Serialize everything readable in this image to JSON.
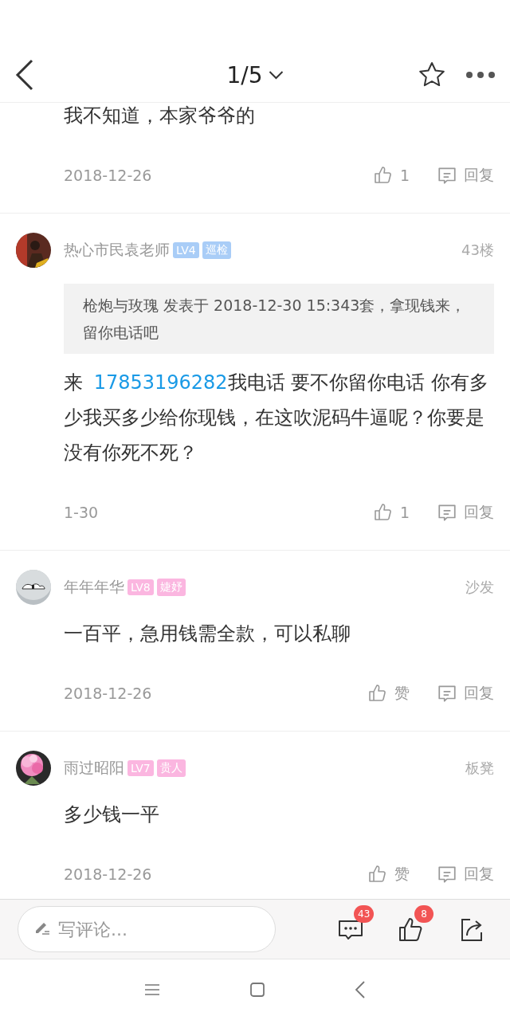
{
  "header": {
    "page": "1/5"
  },
  "first_comment": {
    "content": "我不知道，本家爷爷的",
    "date": "2018-12-26",
    "likes": "1",
    "reply": "回复"
  },
  "comments": [
    {
      "name": "热心市民袁老师",
      "badges": [
        {
          "text": "LV4",
          "color": "#a9cdf7"
        },
        {
          "text": "巡检",
          "color": "#a9cdf7"
        }
      ],
      "floor": "43楼",
      "quote": "枪炮与玫瑰 发表于 2018-12-30 15:343套，拿现钱来，留你电话吧",
      "content": [
        {
          "kind": "text",
          "text": "来 "
        },
        {
          "kind": "phone",
          "text": "17853196282"
        },
        {
          "kind": "text",
          "text": "我电话  要不你留你电话  你有多少我买多少给你现钱，在这吹泥码牛逼呢？你要是没有你死不死？"
        }
      ],
      "date": "1-30",
      "likes": "1",
      "reply": "回复"
    },
    {
      "name": "年年年华",
      "badges": [
        {
          "text": "LV8",
          "color": "#fbb6e0"
        },
        {
          "text": "婕妤",
          "color": "#fbb6e0"
        }
      ],
      "floor": "沙发",
      "content": [
        {
          "kind": "text",
          "text": "一百平，急用钱需全款，可以私聊"
        }
      ],
      "date": "2018-12-26",
      "likes": "赞",
      "reply": "回复"
    },
    {
      "name": "雨过昭阳",
      "badges": [
        {
          "text": "LV7",
          "color": "#fbb6e0"
        },
        {
          "text": "贵人",
          "color": "#fbb6e0"
        }
      ],
      "floor": "板凳",
      "content": [
        {
          "kind": "text",
          "text": "多少钱一平"
        }
      ],
      "date": "2018-12-26",
      "likes": "赞",
      "reply": "回复"
    }
  ],
  "bottom_bar": {
    "placeholder": "写评论...",
    "comment_count": "43",
    "like_count": "8"
  }
}
